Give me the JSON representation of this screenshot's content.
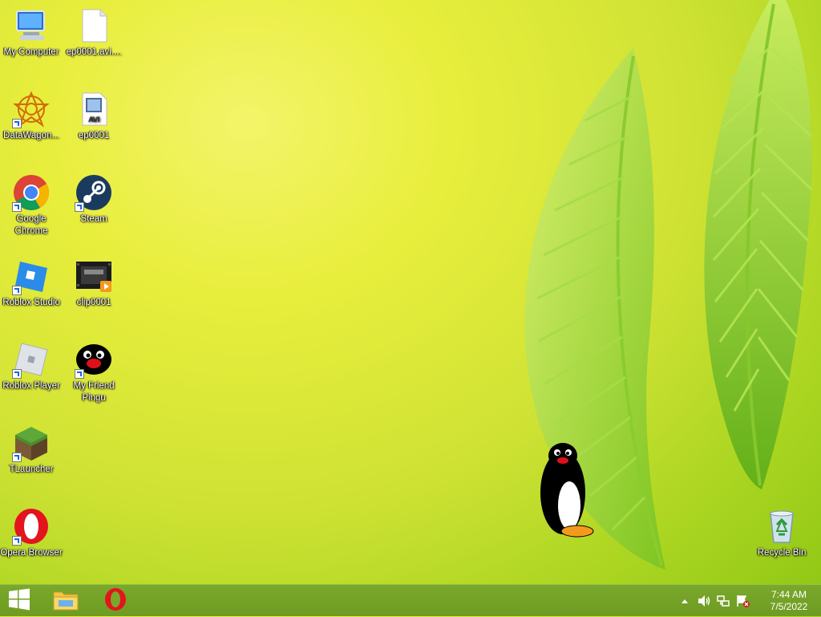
{
  "desktop": {
    "icons": [
      {
        "label": "My Computer",
        "icon": "computer-icon"
      },
      {
        "label": "ep0001.avi....",
        "icon": "blank-file-icon"
      },
      {
        "label": "DataWagon...",
        "icon": "datawagon-icon"
      },
      {
        "label": "ep0001",
        "icon": "avi-file-icon",
        "badge": "AVI"
      },
      {
        "label": "Google Chrome",
        "icon": "chrome-icon"
      },
      {
        "label": "Steam",
        "icon": "steam-icon"
      },
      {
        "label": "Roblox Studio",
        "icon": "roblox-studio-icon"
      },
      {
        "label": "clip0001",
        "icon": "video-clip-icon"
      },
      {
        "label": "Roblox Player",
        "icon": "roblox-player-icon"
      },
      {
        "label": "My Friend Pingu",
        "icon": "pingu-icon"
      },
      {
        "label": "TLauncher",
        "icon": "minecraft-block-icon"
      },
      {
        "label": "Opera Browser",
        "icon": "opera-icon"
      },
      {
        "label": "Recycle Bin",
        "icon": "recycle-bin-icon"
      }
    ]
  },
  "taskbar": {
    "start": "windows-logo-icon",
    "pinned": [
      "file-explorer-icon",
      "opera-icon"
    ],
    "tray_icons": [
      "show-hidden-icons-chevron",
      "volume-icon",
      "network-icon",
      "action-center-flag-icon"
    ],
    "clock": {
      "time": "7:44 AM",
      "date": "7/5/2022"
    }
  },
  "colors": {
    "taskbar": "#7aa82c",
    "wallpaper_light": "#f4f46a",
    "wallpaper_dark": "#8ec614"
  }
}
